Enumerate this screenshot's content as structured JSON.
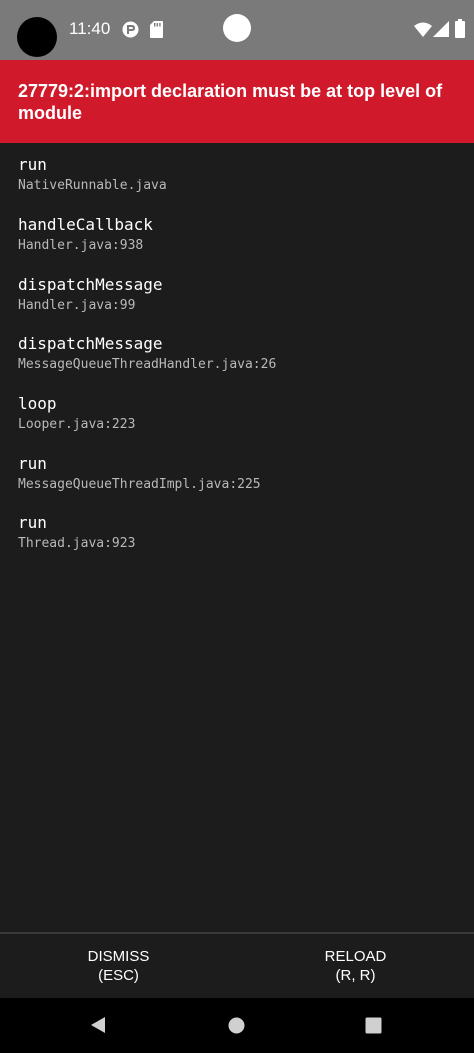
{
  "status_bar": {
    "time": "11:40",
    "icons": [
      "app-notification-icon",
      "sd-card-icon",
      "wifi-icon",
      "cell-signal-icon",
      "battery-icon"
    ]
  },
  "error": {
    "message": "27779:2:import declaration must be at top level of module"
  },
  "stack": [
    {
      "method": "run",
      "file": "NativeRunnable.java"
    },
    {
      "method": "handleCallback",
      "file": "Handler.java:938"
    },
    {
      "method": "dispatchMessage",
      "file": "Handler.java:99"
    },
    {
      "method": "dispatchMessage",
      "file": "MessageQueueThreadHandler.java:26"
    },
    {
      "method": "loop",
      "file": "Looper.java:223"
    },
    {
      "method": "run",
      "file": "MessageQueueThreadImpl.java:225"
    },
    {
      "method": "run",
      "file": "Thread.java:923"
    }
  ],
  "buttons": {
    "dismiss_label": "DISMISS",
    "dismiss_shortcut": "(ESC)",
    "reload_label": "RELOAD",
    "reload_shortcut": "(R, R)"
  },
  "colors": {
    "header": "#d0192a",
    "background": "#1c1c1c",
    "status_bar": "#7a7a7a"
  },
  "nav_bar": {
    "icons": [
      "back-icon",
      "home-icon",
      "recents-icon"
    ]
  }
}
